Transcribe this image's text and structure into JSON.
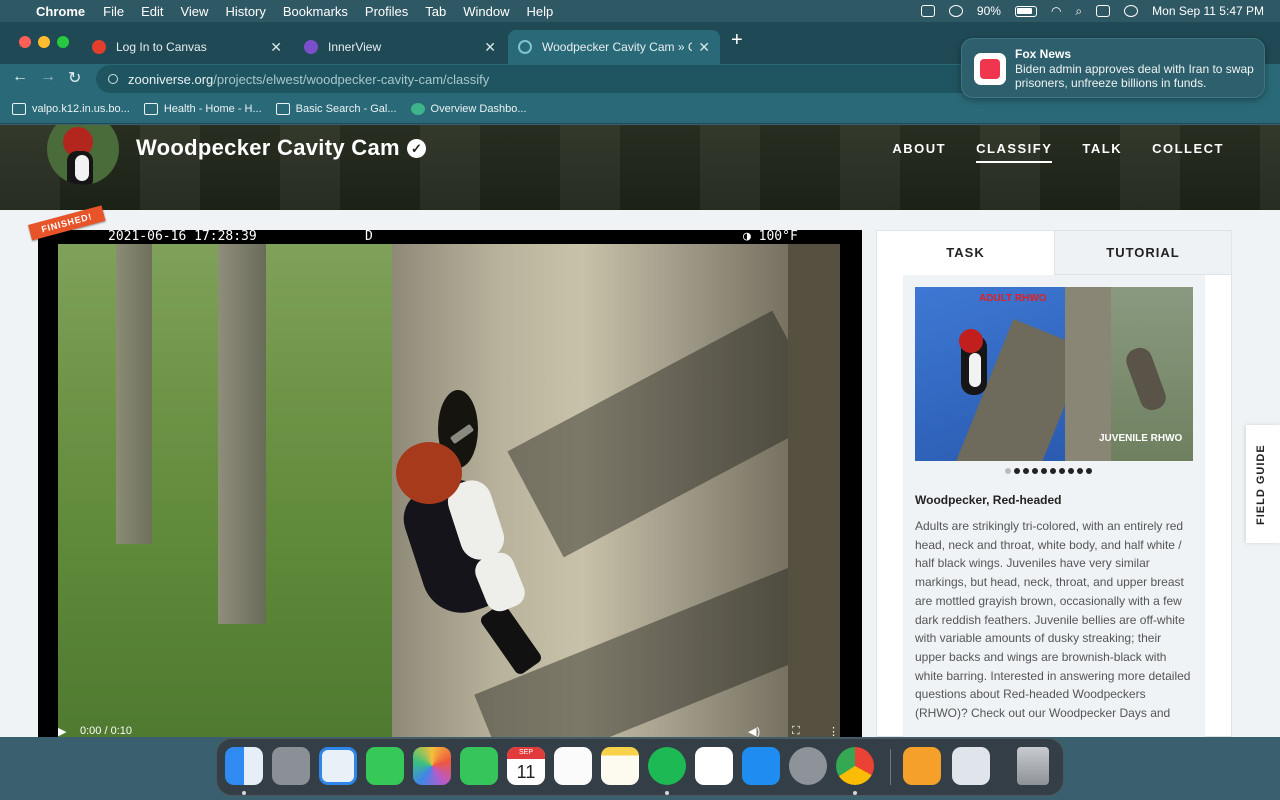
{
  "menubar": {
    "app": "Chrome",
    "items": [
      "File",
      "Edit",
      "View",
      "History",
      "Bookmarks",
      "Profiles",
      "Tab",
      "Window",
      "Help"
    ],
    "battery": "90%",
    "clock": "Mon Sep 11  5:47 PM"
  },
  "browser": {
    "tabs": [
      {
        "label": "Log In to Canvas",
        "favicon_color": "#e13e2b"
      },
      {
        "label": "InnerView",
        "favicon_color": "#7a4fc9"
      },
      {
        "label": "Woodpecker Cavity Cam » Cla",
        "favicon_color": "#7fc3d0"
      }
    ],
    "url_domain": "zooniverse.org",
    "url_path": "/projects/elwest/woodpecker-cavity-cam/classify",
    "bookmarks": [
      "valpo.k12.in.us.bo...",
      "Health - Home - H...",
      "Basic Search - Gal...",
      "Overview Dashbo..."
    ]
  },
  "notification": {
    "source": "Fox News",
    "body": "Biden admin approves deal with Iran to swap prisoners, unfreeze billions in funds."
  },
  "project": {
    "title": "Woodpecker Cavity Cam",
    "nav": [
      "ABOUT",
      "CLASSIFY",
      "TALK",
      "COLLECT"
    ],
    "active_nav": "CLASSIFY"
  },
  "subject": {
    "badge": "FINISHED!",
    "timestamp_date": "2021-06-16 17:28:39",
    "timestamp_mode": "D",
    "timestamp_temp": "◑ 100°F",
    "video_time": "0:00 / 0:10"
  },
  "panel": {
    "tabs": [
      "TASK",
      "TUTORIAL"
    ],
    "image_labels": {
      "adult": "ADULT RHWO",
      "juvenile": "JUVENILE RHWO"
    },
    "species": "Woodpecker, Red-headed",
    "description": "Adults are strikingly tri-colored, with an entirely red head, neck and throat, white body, and half white / half black wings. Juveniles have very similar markings, but head, neck, throat, and upper breast are mottled grayish brown, occasionally with a few dark reddish feathers. Juvenile bellies are off-white with variable amounts of dusky streaking; their upper backs and wings are brownish-black with white barring. Interested in answering more detailed questions about Red-headed Woodpeckers (RHWO)? Check out our Woodpecker Days and",
    "field_guide": "FIELD GUIDE"
  },
  "colors": {
    "accent_badge": "#e8542a",
    "header_bg": "#1e2418",
    "browser_frame": "#2a6a78"
  }
}
